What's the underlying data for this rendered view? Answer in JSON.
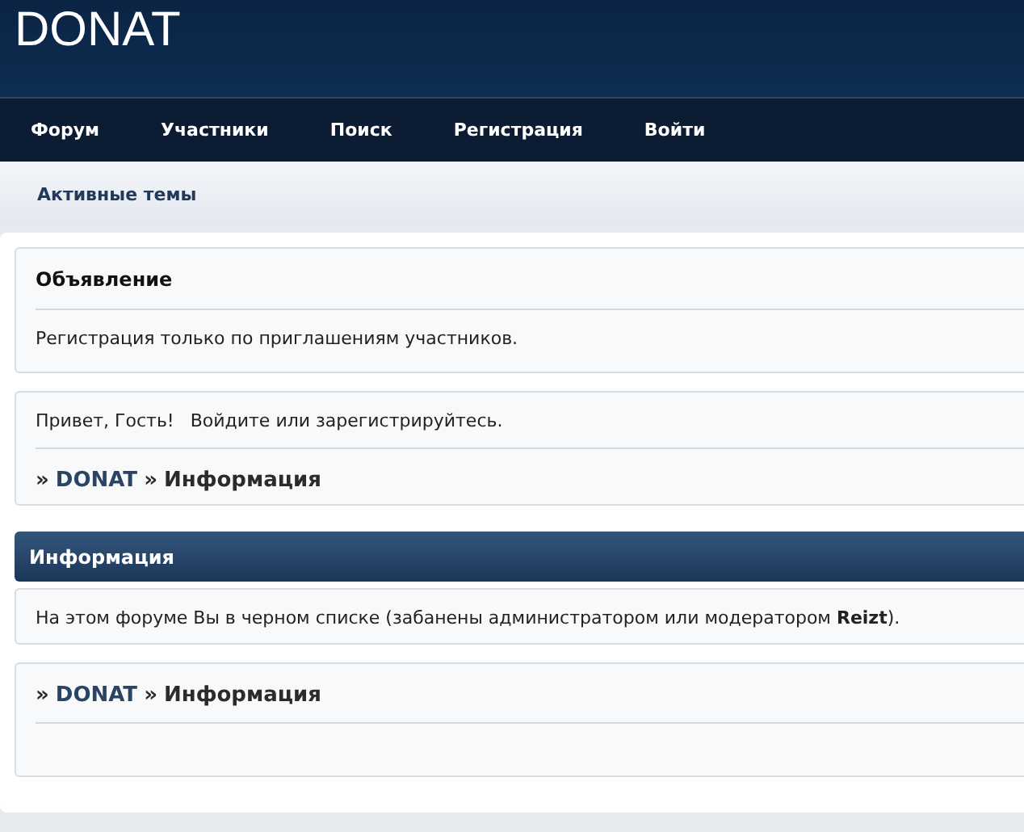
{
  "site": {
    "title": "DONAT"
  },
  "nav": {
    "items": [
      {
        "label": "Форум"
      },
      {
        "label": "Участники"
      },
      {
        "label": "Поиск"
      },
      {
        "label": "Регистрация"
      },
      {
        "label": "Войти"
      }
    ]
  },
  "subnav": {
    "items": [
      {
        "label": "Активные темы"
      }
    ]
  },
  "announcement": {
    "title": "Объявление",
    "text": "Регистрация только по приглашениям участников."
  },
  "welcome": {
    "greeting": "Привет, Гость!",
    "prompt": "Войдите или зарегистрируйтесь.",
    "breadcrumb": [
      {
        "kind": "sep",
        "text": "»"
      },
      {
        "kind": "link",
        "text": "DONAT"
      },
      {
        "kind": "sep",
        "text": "»"
      },
      {
        "kind": "current",
        "text": "Информация"
      }
    ]
  },
  "info": {
    "title": "Информация",
    "text": "На этом форуме Вы в черном списке (забанены администратором или модератором **Reizt**)."
  },
  "footer": {
    "breadcrumb": [
      {
        "kind": "sep",
        "text": "»"
      },
      {
        "kind": "link",
        "text": "DONAT"
      },
      {
        "kind": "sep",
        "text": "»"
      },
      {
        "kind": "current",
        "text": "Информация"
      }
    ]
  }
}
